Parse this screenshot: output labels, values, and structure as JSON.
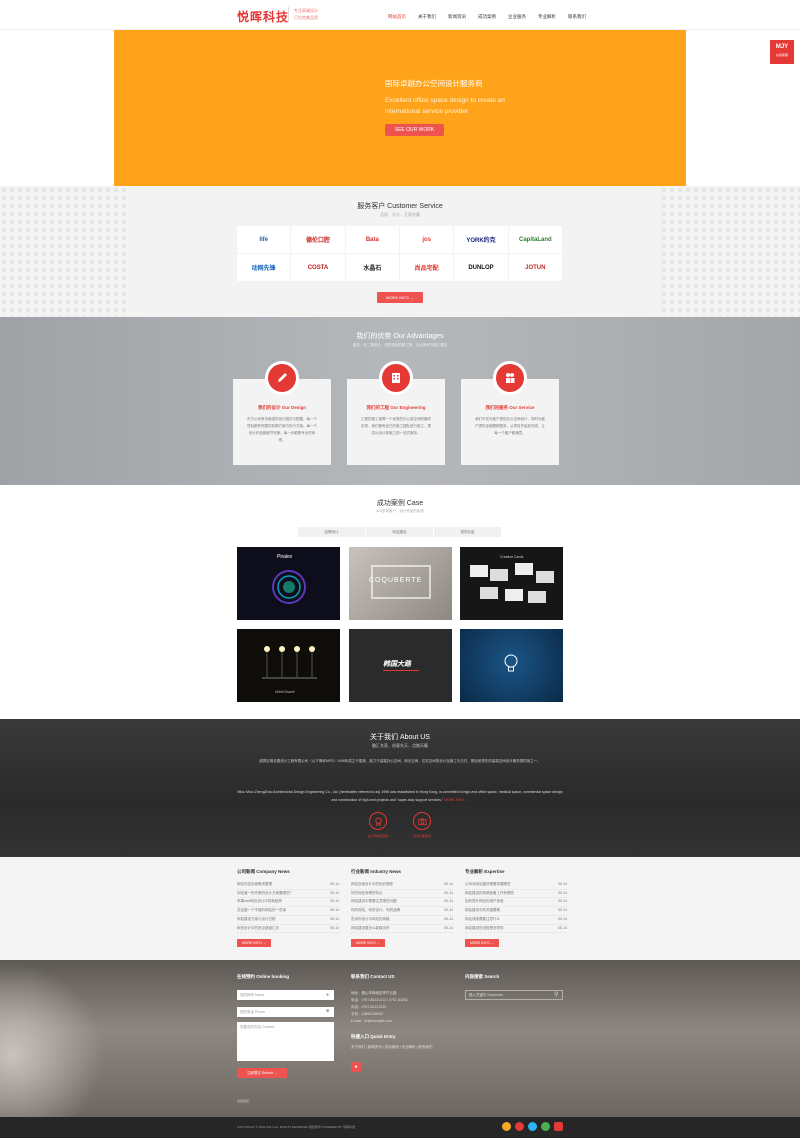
{
  "header": {
    "logo": "悦晖科技",
    "slogan": [
      "专注高端设计",
      "只为完美品质"
    ],
    "nav": [
      "网站首页",
      "关于我们",
      "新闻资讯",
      "成功案例",
      "企业服务",
      "专业解析",
      "联系我们"
    ]
  },
  "badge": {
    "main": "MJY",
    "sub": "在线客服"
  },
  "banner": {
    "title": "国际卓越办公空间设计服务商",
    "subtitle": "Excellent office space design to create an international service provider",
    "button": "SEE OUR WORK",
    "color": "#ffa31a"
  },
  "customers": {
    "title": "服务客户 Customer Service",
    "subtitle": "品质、设计、互惠共赢",
    "logos": [
      {
        "text": "life",
        "color": "#1f5fa5"
      },
      {
        "text": "德伦口腔",
        "color": "#c62828"
      },
      {
        "text": "Bata",
        "color": "#d32f2f"
      },
      {
        "text": "jos",
        "color": "#e53935"
      },
      {
        "text": "YORK约克",
        "color": "#1a237e"
      },
      {
        "text": "CapitaLand",
        "color": "#2e7d32"
      },
      {
        "text": "动网先锋",
        "color": "#1565c0"
      },
      {
        "text": "COSTA",
        "color": "#b71c1c"
      },
      {
        "text": "水晶石",
        "color": "#222222"
      },
      {
        "text": "尚品宅配",
        "color": "#e53935"
      },
      {
        "text": "DUNLOP",
        "color": "#111111"
      },
      {
        "text": "JOTUN",
        "color": "#c62828"
      }
    ],
    "button": "MORE INFO →"
  },
  "advantages": {
    "title": "我们的优势 Our Advantages",
    "subtitle": "独特、全二类设计、资质验收的施工等、办公美化与施工服务",
    "cards": [
      {
        "title": "我们的设计 Our Design",
        "icon": "pencil-icon",
        "text": "东方公司有功能强的设计团队与配置，每一个项目都有完整的前期方案与执行方案。每一个设计作品都细节完美，每一步都是专业的体现。"
      },
      {
        "title": "我们的工程 Our Engineering",
        "icon": "building-icon",
        "text": "工程的施工保障一个优秀的办公室空间的最终实现，我们拥有自己的施工团队进行施工，提供从设计到施工的一站式服务。"
      },
      {
        "title": "我们的服务 Our Service",
        "icon": "people-icon",
        "text": "我们不仅为客户提供办公空间设计，同时为客户提供全程跟踪服务，从项目开始到完成，让每一个客户都满意。"
      }
    ]
  },
  "cases": {
    "title": "成功案例 Case",
    "subtitle": "300多家客户，设计作品的实践",
    "tabs": [
      "品牌设计",
      "网站建设",
      "视觉包装"
    ],
    "items": [
      {
        "caption": "Piralex",
        "bg": "#0d0d1c"
      },
      {
        "caption": "COQUBERTE",
        "bg": "#a9a29c"
      },
      {
        "caption": "Creative Cards",
        "bg": "#161616"
      },
      {
        "caption": "WebShade",
        "bg": "#0f0d0a"
      },
      {
        "caption": "韩国大路",
        "bg": "#2b2b2b"
      },
      {
        "caption": "",
        "bg": "#10365a"
      }
    ]
  },
  "about": {
    "title": "关于我们 About US",
    "subtitle": "融汇名家、创意先天，点燃天籁",
    "text_cn": "越秀区明月路设计工程有限公司（以下简称MPD）1996年成立于香港，致力于高端办公空间、商业空间、住宅空间的设计及施工与交付，是目前领先的高端空间设计服务提供商之一。",
    "text_en": "Miou Miou ZhengZhou Architectural Design Engineering Co., Ltd. (hereinafter referred to as) 1996 was established in Hong Kong, is committed to high-end office space, medical space, commercial space design and construction of high-end projects and \"super-stop support services.\"",
    "more": "MORE INFO →",
    "icons": [
      {
        "icon": "award-icon",
        "label": "设计师精英荟萃"
      },
      {
        "icon": "camera-icon",
        "label": "资源全面整合"
      }
    ]
  },
  "news": [
    {
      "title": "公司新闻 Company News",
      "items": [
        {
          "t": "网站内容页面需求整理",
          "d": "05-14"
        },
        {
          "t": "你知道一份完美的设计方案要哪些？",
          "d": "05-14"
        },
        {
          "t": "苹果web网页设计中的新趋势",
          "d": "05-14"
        },
        {
          "t": "总结做一个不错的网站的一些事",
          "d": "05-14"
        },
        {
          "t": "网站建设方案与设计过程",
          "d": "05-14"
        },
        {
          "t": "网页设计中的常见错误汇总",
          "d": "05-14"
        }
      ],
      "more": "MORE INFO →"
    },
    {
      "title": "行业新闻 Industry News",
      "items": [
        {
          "t": "网站页面设计中的色彩搭配",
          "d": "05-14"
        },
        {
          "t": "好的网站有哪些特点",
          "d": "05-14"
        },
        {
          "t": "网站建设中需要注意哪些问题",
          "d": "05-14"
        },
        {
          "t": "你的网站，你的设计，你的品牌",
          "d": "05-14"
        },
        {
          "t": "告诉你设计中网站的风格",
          "d": "05-14"
        },
        {
          "t": "网站建设要怎么能建设好",
          "d": "05-14"
        }
      ],
      "more": "MORE INFO →"
    },
    {
      "title": "专业解析 Expertise",
      "items": [
        {
          "t": "公司对网站建设需要掌握哪些",
          "d": "05-14"
        },
        {
          "t": "网站建设的前期准备工作有哪些",
          "d": "05-14"
        },
        {
          "t": "如何提升网站的用户体验",
          "d": "05-14"
        },
        {
          "t": "网站建设中的关键要素",
          "d": "05-14"
        },
        {
          "t": "网站改版需要注意什么",
          "d": "05-14"
        },
        {
          "t": "网站建设的流程是怎样的",
          "d": "05-14"
        }
      ],
      "more": "MORE INFO →"
    }
  ],
  "contact": {
    "booking_title": "在线预约 Online booking",
    "name_placeholder": "您的称呼 Name",
    "phone_placeholder": "您的电话 Phone",
    "message_placeholder": "您要说的内容 Content",
    "submit": "立即提交 Submit →",
    "contact_title": "联系我们 Contact US",
    "lines": [
      "地址：佛山市禅城区季华五路",
      "电话：0757-83131213 / 0757-83262",
      "传真：0757-83131233",
      "手机：13800138000",
      "E-mail：hr@example.com"
    ],
    "quick_title": "快捷入口 Quick Entry",
    "quick_links": "关于我们 | 新闻资讯 | 成功案例 | 专业解析 | 联系我们",
    "search_title": "内容搜索 Search",
    "search_placeholder": "输入关键字 Keywords",
    "small_link": "友情链接"
  },
  "footer": {
    "copyright": "COPYRIGHT © 2003-2017 ALL RIGHTS RESERVED 版权所有 POWERED BY 悦晖科技"
  }
}
